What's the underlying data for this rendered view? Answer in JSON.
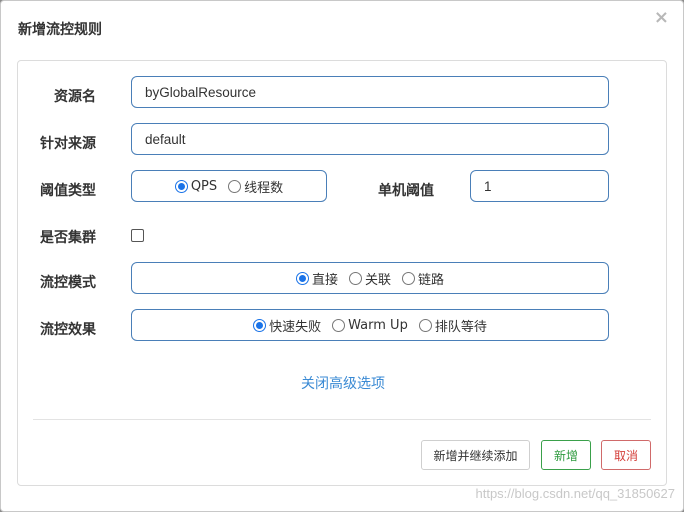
{
  "dialog": {
    "title": "新增流控规则",
    "close_glyph": "×"
  },
  "form": {
    "resource_label": "资源名",
    "resource_value": "byGlobalResource",
    "limit_app_label": "针对来源",
    "limit_app_value": "default",
    "grade_label": "阈值类型",
    "grade_options": [
      "QPS",
      "线程数"
    ],
    "grade_selected": "QPS",
    "count_label": "单机阈值",
    "count_value": "1",
    "cluster_label": "是否集群",
    "cluster_checked": false,
    "strategy_label": "流控模式",
    "strategy_options": [
      "直接",
      "关联",
      "链路"
    ],
    "strategy_selected": "直接",
    "behavior_label": "流控效果",
    "behavior_options": [
      "快速失败",
      "Warm Up",
      "排队等待"
    ],
    "behavior_selected": "快速失败"
  },
  "advanced_toggle": "关闭高级选项",
  "footer": {
    "continue_label": "新增并继续添加",
    "add_label": "新增",
    "cancel_label": "取消"
  },
  "watermark": "https://blog.csdn.net/qq_31850627",
  "colors": {
    "input_border": "#4a7fb8",
    "link": "#3a8ad4",
    "add_button": "#2e9a3e",
    "cancel_button": "#d43f3a",
    "radio_checked": "#1a73e8"
  }
}
